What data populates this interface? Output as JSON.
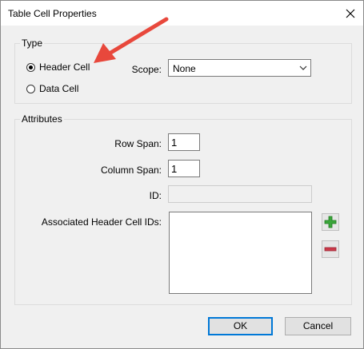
{
  "window": {
    "title": "Table Cell Properties"
  },
  "type_group": {
    "label": "Type",
    "header_cell_label": "Header Cell",
    "data_cell_label": "Data Cell",
    "scope_label": "Scope:",
    "scope_value": "None"
  },
  "attributes_group": {
    "label": "Attributes",
    "row_span_label": "Row Span:",
    "row_span_value": "1",
    "column_span_label": "Column Span:",
    "column_span_value": "1",
    "id_label": "ID:",
    "id_value": "",
    "associated_label": "Associated Header Cell IDs:"
  },
  "buttons": {
    "ok": "OK",
    "cancel": "Cancel"
  },
  "colors": {
    "annotation": "#e8483c",
    "add": "#3aa63a",
    "remove": "#cc3a4a",
    "accent": "#0078d7"
  }
}
